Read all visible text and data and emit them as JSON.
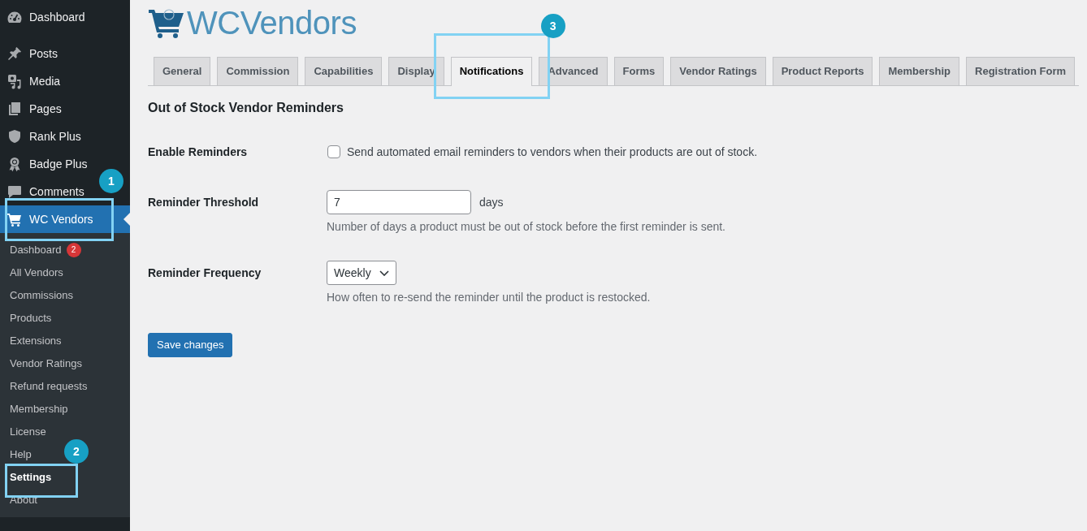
{
  "sidebar": {
    "menu": [
      {
        "label": "Dashboard",
        "selected": false
      },
      {
        "label": "Posts",
        "selected": false
      },
      {
        "label": "Media",
        "selected": false
      },
      {
        "label": "Pages",
        "selected": false
      },
      {
        "label": "Rank Plus",
        "selected": false
      },
      {
        "label": "Badge Plus",
        "selected": false
      },
      {
        "label": "Comments",
        "selected": false
      },
      {
        "label": "WC Vendors",
        "selected": true,
        "callout": "1",
        "children": [
          {
            "label": "Dashboard",
            "badge": "2",
            "selected": false
          },
          {
            "label": "All Vendors",
            "selected": false
          },
          {
            "label": "Commissions",
            "selected": false
          },
          {
            "label": "Products",
            "selected": false
          },
          {
            "label": "Extensions",
            "selected": false
          },
          {
            "label": "Vendor Ratings",
            "selected": false
          },
          {
            "label": "Refund requests",
            "selected": false
          },
          {
            "label": "Membership",
            "selected": false
          },
          {
            "label": "License",
            "selected": false
          },
          {
            "label": "Help",
            "selected": false
          },
          {
            "label": "Settings",
            "selected": true,
            "callout": "2"
          },
          {
            "label": "About",
            "selected": false
          }
        ]
      }
    ]
  },
  "logo": {
    "text": "WCVendors"
  },
  "tabs": [
    {
      "label": "General",
      "selected": false
    },
    {
      "label": "Commission",
      "selected": false
    },
    {
      "label": "Capabilities",
      "selected": false
    },
    {
      "label": "Display",
      "selected": false
    },
    {
      "label": "Notifications",
      "selected": true,
      "callout": "3"
    },
    {
      "label": "Advanced",
      "selected": false
    },
    {
      "label": "Forms",
      "selected": false
    },
    {
      "label": "Vendor Ratings",
      "selected": false
    },
    {
      "label": "Product Reports",
      "selected": false
    },
    {
      "label": "Membership",
      "selected": false
    },
    {
      "label": "Registration Form",
      "selected": false
    }
  ],
  "section_title": "Out of Stock Vendor Reminders",
  "fields": [
    {
      "kind": "checkbox",
      "label": "Enable Reminders",
      "checked": false,
      "text": "Send automated email reminders to vendors when their products are out of stock."
    },
    {
      "kind": "number",
      "label": "Reminder Threshold",
      "value": "7",
      "suffix": "days",
      "description": "Number of days a product must be out of stock before the first reminder is sent."
    },
    {
      "kind": "select",
      "label": "Reminder Frequency",
      "value": "Weekly",
      "description": "How often to re-send the reminder until the product is restocked."
    }
  ],
  "save_button": {
    "label": "Save changes"
  }
}
